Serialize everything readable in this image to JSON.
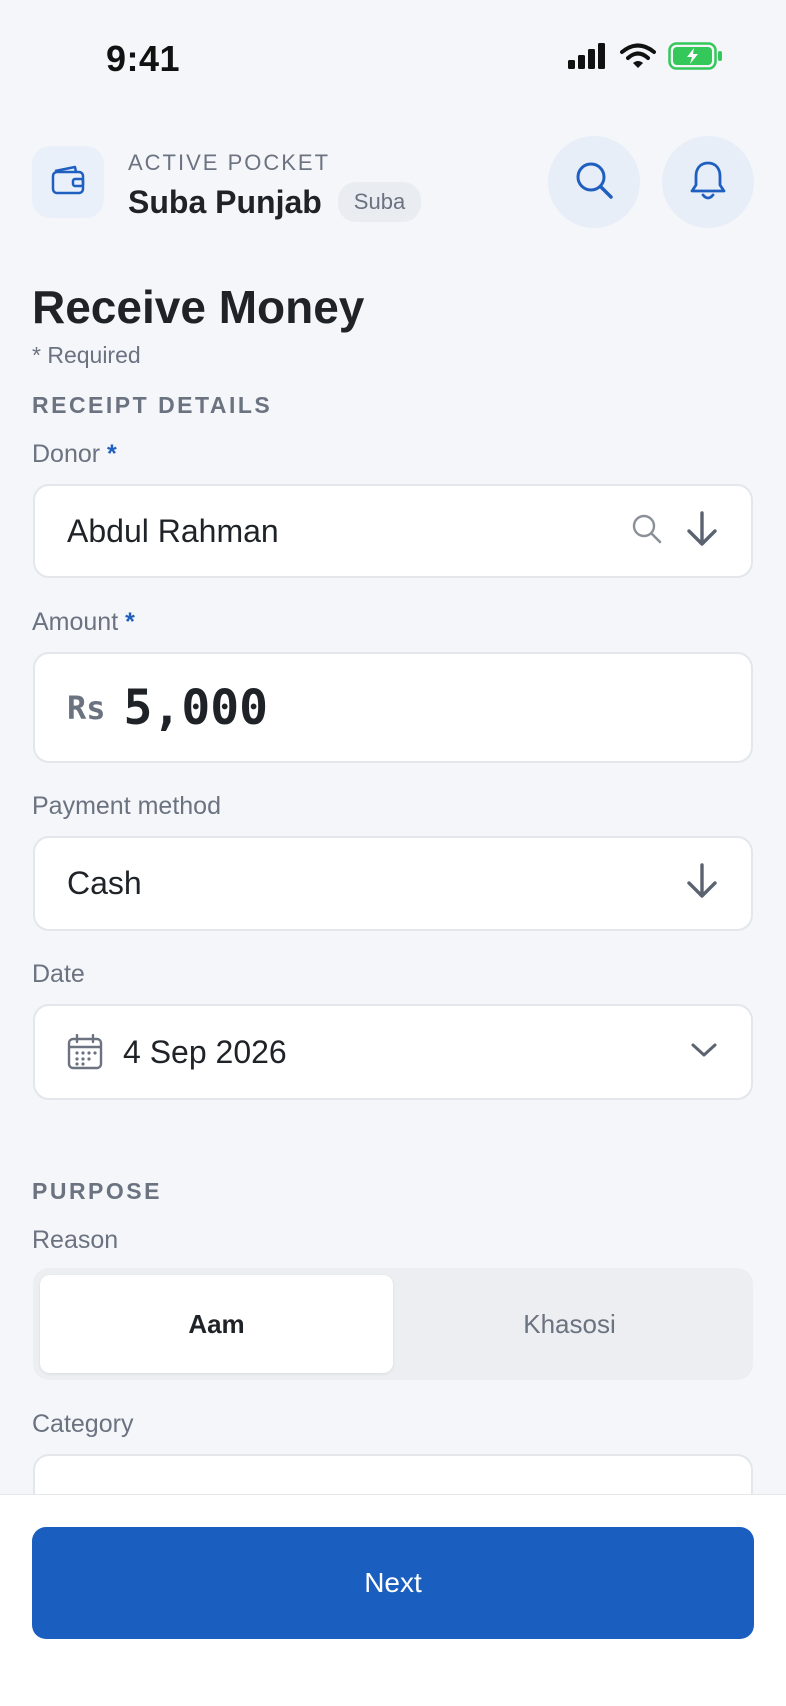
{
  "status_bar": {
    "time": "9:41",
    "battery_color": "#34c759"
  },
  "header": {
    "pocket_caption": "ACTIVE POCKET",
    "pocket_name": "Suba Punjab",
    "pocket_badge": "Suba",
    "icons": {
      "wallet": "wallet-icon",
      "search": "search-icon",
      "bell": "bell-icon"
    }
  },
  "page": {
    "title": "Receive Money",
    "required_note": "* Required"
  },
  "receipt": {
    "section_label": "RECEIPT DETAILS",
    "donor": {
      "label": "Donor",
      "required": "*",
      "value": "Abdul Rahman"
    },
    "amount": {
      "label": "Amount",
      "required": "*",
      "currency": "Rs",
      "value": "5,000"
    },
    "payment": {
      "label": "Payment method",
      "value": "Cash"
    },
    "date": {
      "label": "Date",
      "value": "4 Sep 2026"
    }
  },
  "purpose": {
    "section_label": "PURPOSE",
    "reason": {
      "label": "Reason",
      "options": [
        "Aam",
        "Khasosi"
      ],
      "selected": "Aam"
    },
    "category": {
      "label": "Category"
    }
  },
  "footer": {
    "next_label": "Next"
  },
  "colors": {
    "accent": "#1a5fc0",
    "background": "#f4f6fa"
  }
}
